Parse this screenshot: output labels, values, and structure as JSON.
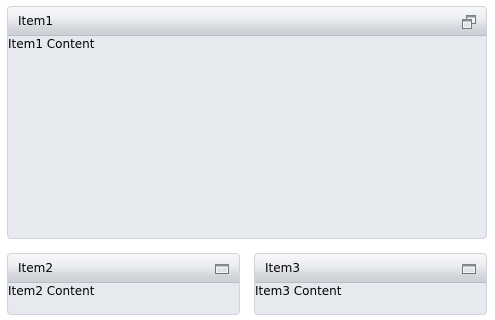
{
  "tiles": [
    {
      "title": "Item1",
      "content": "Item1 Content",
      "state": "maximized",
      "button_icon": "restore-icon"
    },
    {
      "title": "Item2",
      "content": "Item2 Content",
      "state": "minimized",
      "button_icon": "maximize-icon"
    },
    {
      "title": "Item3",
      "content": "Item3 Content",
      "state": "minimized",
      "button_icon": "maximize-icon"
    }
  ],
  "colors": {
    "tile_background": "#e6eaee",
    "tile_border": "#cfd4da",
    "header_top": "#f7f8f9",
    "header_bottom": "#cdd1d6",
    "icon_stroke": "#6e7680"
  }
}
